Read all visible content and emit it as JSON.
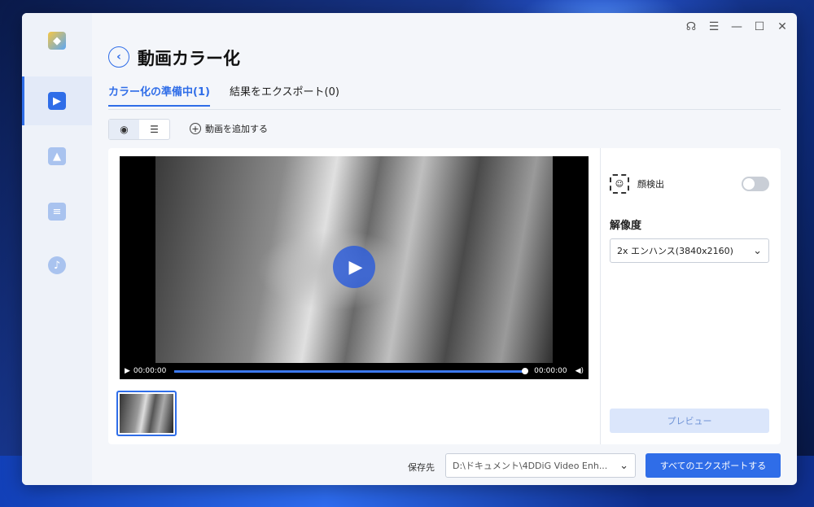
{
  "window": {
    "title": "動画カラー化",
    "controls": [
      "headset-icon",
      "menu-icon",
      "minimize-icon",
      "maximize-icon",
      "close-icon"
    ]
  },
  "sidebar": {
    "items": [
      {
        "name": "logo",
        "icon": "app-logo-icon"
      },
      {
        "name": "video",
        "icon": "video-icon",
        "active": true
      },
      {
        "name": "photo",
        "icon": "image-icon"
      },
      {
        "name": "document",
        "icon": "document-icon"
      },
      {
        "name": "audio",
        "icon": "music-icon"
      }
    ]
  },
  "tabs": [
    {
      "label": "カラー化の準備中(1)",
      "active": true
    },
    {
      "label": "結果をエクスポート(0)",
      "active": false
    }
  ],
  "toolbar": {
    "add_video_label": "動画を追加する"
  },
  "player": {
    "current_time": "00:00:00",
    "duration": "00:00:00"
  },
  "settings": {
    "face_detect_label": "顔検出",
    "face_detect_on": false,
    "resolution_label": "解像度",
    "resolution_value": "2x エンハンス(3840x2160)",
    "preview_label": "プレビュー"
  },
  "footer": {
    "save_to_label": "保存先",
    "save_path": "D:\\ドキュメント\\4DDiG Video Enh...",
    "export_all_label": "すべてのエクスポートする"
  },
  "colors": {
    "accent": "#2f6de8",
    "preview_bg": "#dbe6fb"
  }
}
